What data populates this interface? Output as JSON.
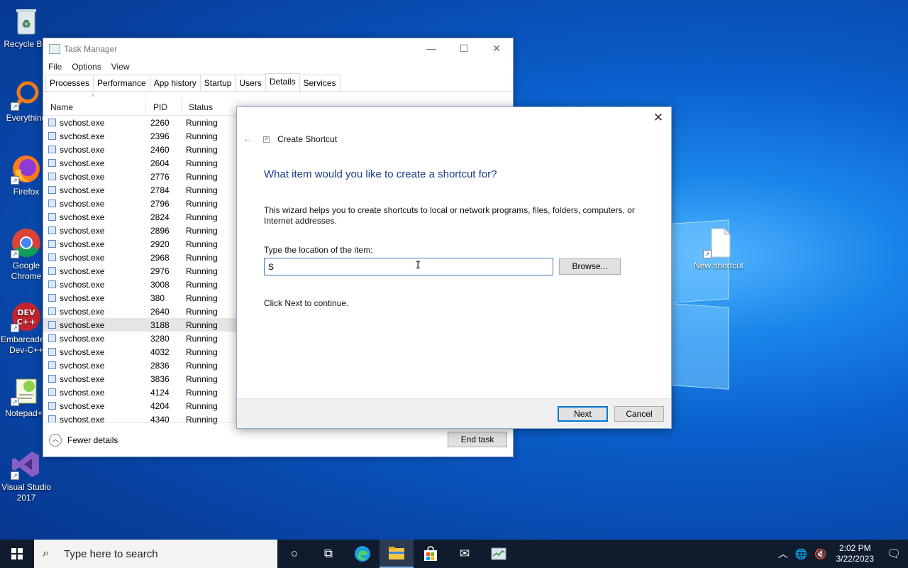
{
  "desktop": {
    "icons": [
      {
        "label": "Recycle Bin"
      },
      {
        "label": "Everything"
      },
      {
        "label": "Firefox"
      },
      {
        "label": "Google Chrome"
      },
      {
        "label": "Embarcadero Dev-C++"
      },
      {
        "label": "Notepad++"
      },
      {
        "label": "Visual Studio 2017"
      },
      {
        "label": "New shortcut"
      }
    ]
  },
  "task_manager": {
    "title": "Task Manager",
    "menu": [
      "File",
      "Options",
      "View"
    ],
    "tabs": [
      "Processes",
      "Performance",
      "App history",
      "Startup",
      "Users",
      "Details",
      "Services"
    ],
    "active_tab": "Details",
    "columns": [
      "Name",
      "PID",
      "Status"
    ],
    "rows": [
      {
        "name": "svchost.exe",
        "pid": "2260",
        "status": "Running"
      },
      {
        "name": "svchost.exe",
        "pid": "2396",
        "status": "Running"
      },
      {
        "name": "svchost.exe",
        "pid": "2460",
        "status": "Running"
      },
      {
        "name": "svchost.exe",
        "pid": "2604",
        "status": "Running"
      },
      {
        "name": "svchost.exe",
        "pid": "2776",
        "status": "Running"
      },
      {
        "name": "svchost.exe",
        "pid": "2784",
        "status": "Running"
      },
      {
        "name": "svchost.exe",
        "pid": "2796",
        "status": "Running"
      },
      {
        "name": "svchost.exe",
        "pid": "2824",
        "status": "Running"
      },
      {
        "name": "svchost.exe",
        "pid": "2896",
        "status": "Running"
      },
      {
        "name": "svchost.exe",
        "pid": "2920",
        "status": "Running"
      },
      {
        "name": "svchost.exe",
        "pid": "2968",
        "status": "Running"
      },
      {
        "name": "svchost.exe",
        "pid": "2976",
        "status": "Running"
      },
      {
        "name": "svchost.exe",
        "pid": "3008",
        "status": "Running"
      },
      {
        "name": "svchost.exe",
        "pid": "380",
        "status": "Running"
      },
      {
        "name": "svchost.exe",
        "pid": "2640",
        "status": "Running"
      },
      {
        "name": "svchost.exe",
        "pid": "3188",
        "status": "Running",
        "selected": true
      },
      {
        "name": "svchost.exe",
        "pid": "3280",
        "status": "Running"
      },
      {
        "name": "svchost.exe",
        "pid": "4032",
        "status": "Running"
      },
      {
        "name": "svchost.exe",
        "pid": "2836",
        "status": "Running"
      },
      {
        "name": "svchost.exe",
        "pid": "3836",
        "status": "Running"
      },
      {
        "name": "svchost.exe",
        "pid": "4124",
        "status": "Running"
      },
      {
        "name": "svchost.exe",
        "pid": "4204",
        "status": "Running"
      },
      {
        "name": "svchost.exe",
        "pid": "4340",
        "status": "Running"
      }
    ],
    "fewer_details": "Fewer details",
    "end_task": "End task"
  },
  "dialog": {
    "title": "Create Shortcut",
    "question": "What item would you like to create a shortcut for?",
    "description": "This wizard helps you to create shortcuts to local or network programs, files, folders, computers, or Internet addresses.",
    "location_label": "Type the location of the item:",
    "location_value": "S",
    "browse": "Browse...",
    "hint": "Click Next to continue.",
    "next": "Next",
    "cancel": "Cancel"
  },
  "taskbar": {
    "search_placeholder": "Type here to search",
    "time": "2:02 PM",
    "date": "3/22/2023"
  },
  "colors": {
    "accent": "#0078d7",
    "dialog_heading": "#1d3a8c",
    "taskbar": "#101c2e"
  }
}
